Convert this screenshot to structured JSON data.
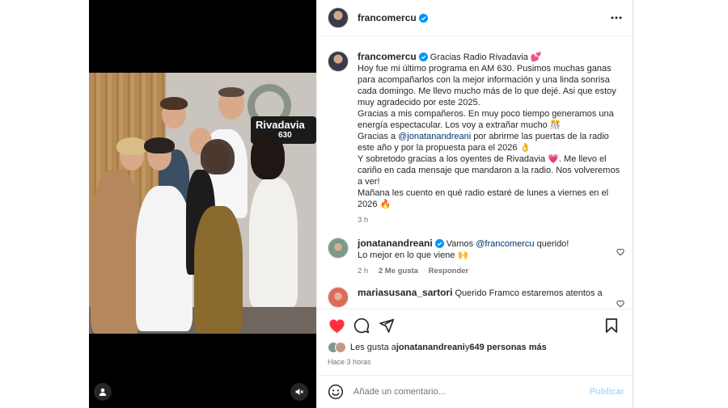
{
  "post": {
    "author": "francomercu",
    "caption": [
      {
        "text": "Gracias Radio Rivadavia 💕"
      },
      {
        "text": "Hoy fue mi último programa en AM 630. Pusimos muchas ganas para acompañarlos con la mejor información y una linda sonrisa cada domingo. Me llevo mucho más de lo que dejé. Asi que estoy muy agradecido por este 2025."
      },
      {
        "text": "Gracias a mis compañeros. En muy poco tiempo generamos una energía espectacular. Los voy a extrañar mucho 🎊"
      },
      {
        "prefix": "Gracias a ",
        "mention": "@jonatanandreani",
        "suffix": " por abrirme las puertas de la radio este año y por la propuesta para el 2026 👌"
      },
      {
        "text": "Y sobretodo gracias a los oyentes de Rivadavia 💗. Me llevo el cariño en cada mensaje que mandaron a la radio. Nos volveremos a ver!"
      },
      {
        "text": "Mañana les cuento en qué radio estaré de lunes a viernes en el 2026 🔥"
      }
    ],
    "caption_time": "3 h",
    "photo_sign": {
      "name": "Rivadavia",
      "number": "630"
    }
  },
  "comments": [
    {
      "user": "jonatanandreani",
      "verified": true,
      "text_prefix": "Vamos ",
      "mention": "@francomercu",
      "text_suffix": " querido!",
      "text_line2": "Lo mejor en lo que viene 🙌",
      "time": "2 h",
      "likes": "2 Me gusta",
      "reply": "Responder"
    },
    {
      "user": "mariasusana_sartori",
      "verified": false,
      "text": "Querido Framco estaremos atentos a"
    }
  ],
  "likes": {
    "prefix": "Les gusta a ",
    "user": "jonatanandreani",
    "middle": " y ",
    "others": "649 personas más"
  },
  "time_ago": "Hace 3 horas",
  "add_comment": {
    "placeholder": "Añade un comentario...",
    "publish": "Publicar"
  },
  "colors": {
    "like_red": "#ff3040",
    "verified_blue": "#0095f6",
    "link": "#00376b",
    "publish_disabled": "#b3dbff"
  },
  "icons": [
    "user-tag-icon",
    "mute-icon",
    "more-icon",
    "verified-icon",
    "heart-icon",
    "comment-icon",
    "share-icon",
    "save-icon",
    "emoji-icon"
  ]
}
